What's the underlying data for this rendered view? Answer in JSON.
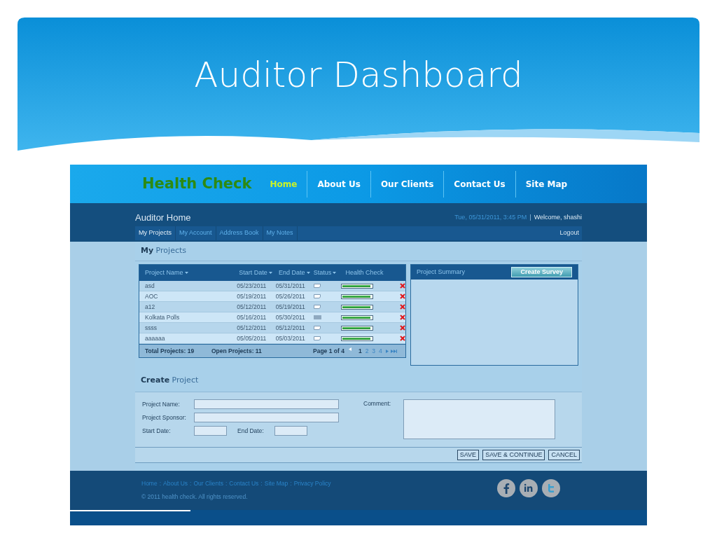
{
  "slide_title": "Auditor Dashboard",
  "site": {
    "logo": "Health Check",
    "nav": [
      {
        "label": "Home",
        "selected": true
      },
      {
        "label": "About Us",
        "selected": false
      },
      {
        "label": "Our Clients",
        "selected": false
      },
      {
        "label": "Contact Us",
        "selected": false
      },
      {
        "label": "Site Map",
        "selected": false
      }
    ],
    "page_title": "Auditor Home",
    "datetime": "Tue, 05/31/2011, 3:45 PM",
    "divider": "|",
    "welcome": "Welcome, shashi",
    "subnav": [
      {
        "label": "My Projects",
        "selected": true
      },
      {
        "label": "My Account",
        "selected": false
      },
      {
        "label": "Address Book",
        "selected": false
      },
      {
        "label": "My Notes",
        "selected": false
      }
    ],
    "logout": "Logout"
  },
  "projects": {
    "heading_bold": "My",
    "heading": "Projects",
    "columns": [
      {
        "label": "Project Name",
        "sortable": true
      },
      {
        "label": "Start Date",
        "sortable": true
      },
      {
        "label": "End Date",
        "sortable": true
      },
      {
        "label": "Status",
        "sortable": true
      },
      {
        "label": "Health Check",
        "sortable": false
      }
    ],
    "rows": [
      {
        "name": "asd",
        "start": "05/23/2011",
        "end": "05/31/2011",
        "kind": "flag",
        "level": 0.94
      },
      {
        "name": "AOC",
        "start": "05/19/2011",
        "end": "05/26/2011",
        "kind": "flag",
        "level": 0.94
      },
      {
        "name": "a12",
        "start": "05/12/2011",
        "end": "05/19/2011",
        "kind": "flag",
        "level": 0.94
      },
      {
        "name": "Kolkata Polls",
        "start": "05/16/2011",
        "end": "05/30/2011",
        "kind": "block",
        "level": 0.94
      },
      {
        "name": "ssss",
        "start": "05/12/2011",
        "end": "05/12/2011",
        "kind": "flag",
        "level": 0.94
      },
      {
        "name": "aaaaaa",
        "start": "05/05/2011",
        "end": "05/03/2011",
        "kind": "flag",
        "level": 0.94
      }
    ],
    "total": "Total Projects: 19",
    "open": "Open Projects: 11",
    "page_info": "Page 1 of 4",
    "pages": [
      {
        "label": "1",
        "selected": true
      },
      {
        "label": "2",
        "selected": false
      },
      {
        "label": "3",
        "selected": false
      },
      {
        "label": "4",
        "selected": false
      }
    ]
  },
  "summary": {
    "title": "Project Summary",
    "button": "Create Survey"
  },
  "create": {
    "heading_bold": "Create",
    "heading": "Project",
    "project_name": "Project Name:",
    "project_sponsor": "Project Sponsor:",
    "start_date": "Start Date:",
    "end_date": "End Date:",
    "comment": "Comment:",
    "buttons": [
      "SAVE",
      "SAVE & CONTINUE",
      "CANCEL"
    ]
  },
  "footer": {
    "links": [
      "Home",
      "About Us",
      "Our Clients",
      "Contact Us",
      "Site Map",
      "Privacy Policy"
    ],
    "separator": ":",
    "copyright": "© 2011 health check. All rights reserved."
  }
}
